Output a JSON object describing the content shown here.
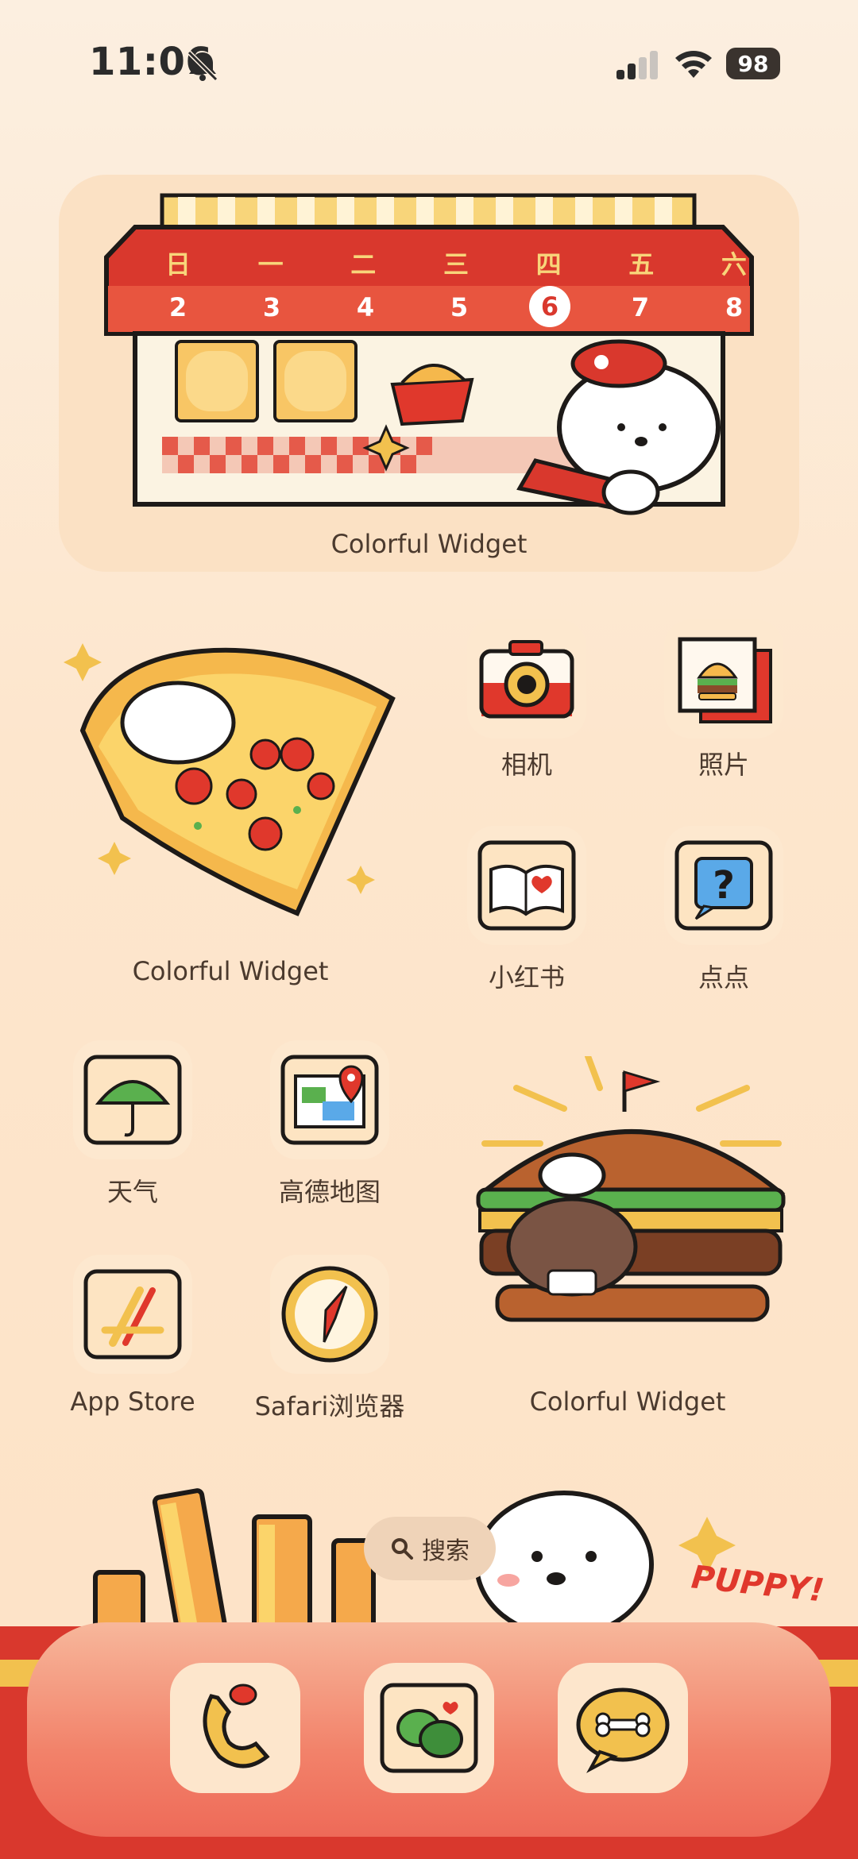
{
  "status_bar": {
    "time": "11:06",
    "battery": "98"
  },
  "widgets": {
    "calendar": {
      "weekdays": [
        "日",
        "一",
        "二",
        "三",
        "四",
        "五",
        "六"
      ],
      "dates": [
        "2",
        "3",
        "4",
        "5",
        "6",
        "7",
        "8"
      ],
      "today": "6",
      "label": "Colorful Widget"
    },
    "pizza": {
      "label": "Colorful Widget"
    },
    "burger": {
      "label": "Colorful Widget"
    }
  },
  "apps": {
    "camera": "相机",
    "photos": "照片",
    "xiaohongshu": "小红书",
    "diandian": "点点",
    "weather": "天气",
    "amap": "高德地图",
    "appstore": "App Store",
    "safari": "Safari浏览器"
  },
  "search": {
    "label": "搜索"
  },
  "banner": {
    "text": "PUPPY!"
  },
  "colors": {
    "accent_red": "#e0382c",
    "cream": "#fde6cd",
    "mustard": "#f2c14e"
  }
}
